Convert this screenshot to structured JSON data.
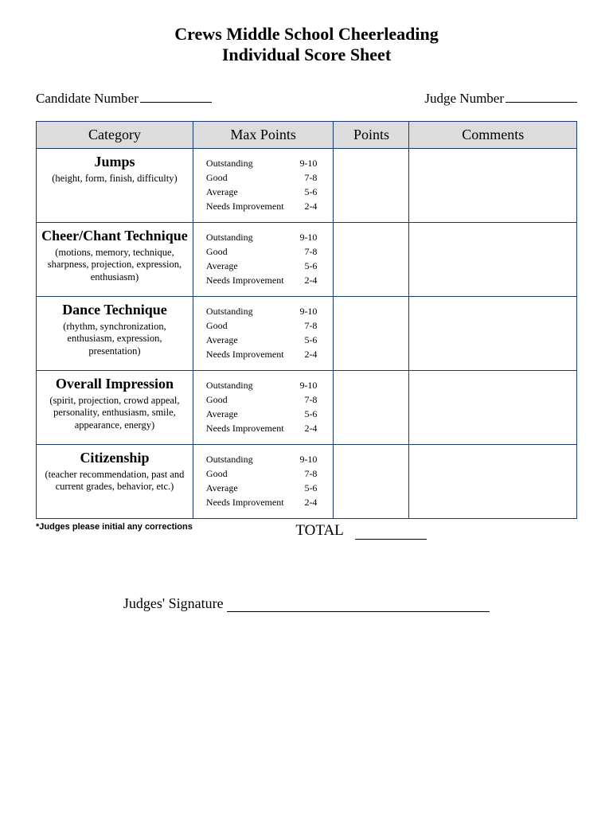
{
  "title": {
    "line1": "Crews Middle School Cheerleading",
    "line2": "Individual Score Sheet"
  },
  "fields": {
    "candidate_label": "Candidate Number",
    "judge_label": "Judge Number"
  },
  "headers": {
    "category": "Category",
    "max_points": "Max Points",
    "points": "Points",
    "comments": "Comments"
  },
  "rubric": [
    {
      "label": "Outstanding",
      "range": "9-10"
    },
    {
      "label": "Good",
      "range": "7-8"
    },
    {
      "label": "Average",
      "range": "5-6"
    },
    {
      "label": "Needs Improvement",
      "range": "2-4"
    }
  ],
  "categories": [
    {
      "name": "Jumps",
      "desc": "(height, form, finish, difficulty)"
    },
    {
      "name": "Cheer/Chant Technique",
      "desc": "(motions, memory, technique, sharpness, projection, expression, enthusiasm)"
    },
    {
      "name": "Dance Technique",
      "desc": "(rhythm, synchronization, enthusiasm, expression, presentation)"
    },
    {
      "name": "Overall Impression",
      "desc": "(spirit, projection, crowd appeal, personality, enthusiasm, smile, appearance, energy)"
    },
    {
      "name": "Citizenship",
      "desc": "(teacher recommendation, past and current grades, behavior, etc.)"
    }
  ],
  "footnote": "*Judges please initial any corrections",
  "total_label": "TOTAL",
  "signature_label": "Judges' Signature"
}
